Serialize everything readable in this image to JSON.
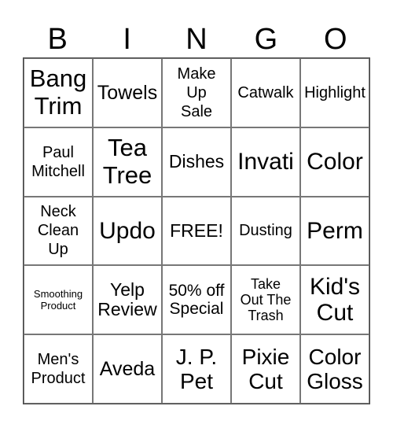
{
  "header": [
    "B",
    "I",
    "N",
    "G",
    "O"
  ],
  "cells": [
    [
      "Bang\nTrim",
      "Towels",
      "Make\nUp\nSale",
      "Catwalk",
      "Highlight"
    ],
    [
      "Paul\nMitchell",
      "Tea\nTree",
      "Dishes",
      "Invati",
      "Color"
    ],
    [
      "Neck\nClean\nUp",
      "Updo",
      "FREE!",
      "Dusting",
      "Perm"
    ],
    [
      "Smoothing\nProduct",
      "Yelp\nReview",
      "50% off\nSpecial",
      "Take\nOut The\nTrash",
      "Kid's\nCut"
    ],
    [
      "Men's\nProduct",
      "Aveda",
      "J. P.\nPet",
      "Pixie\nCut",
      "Color\nGloss"
    ]
  ]
}
